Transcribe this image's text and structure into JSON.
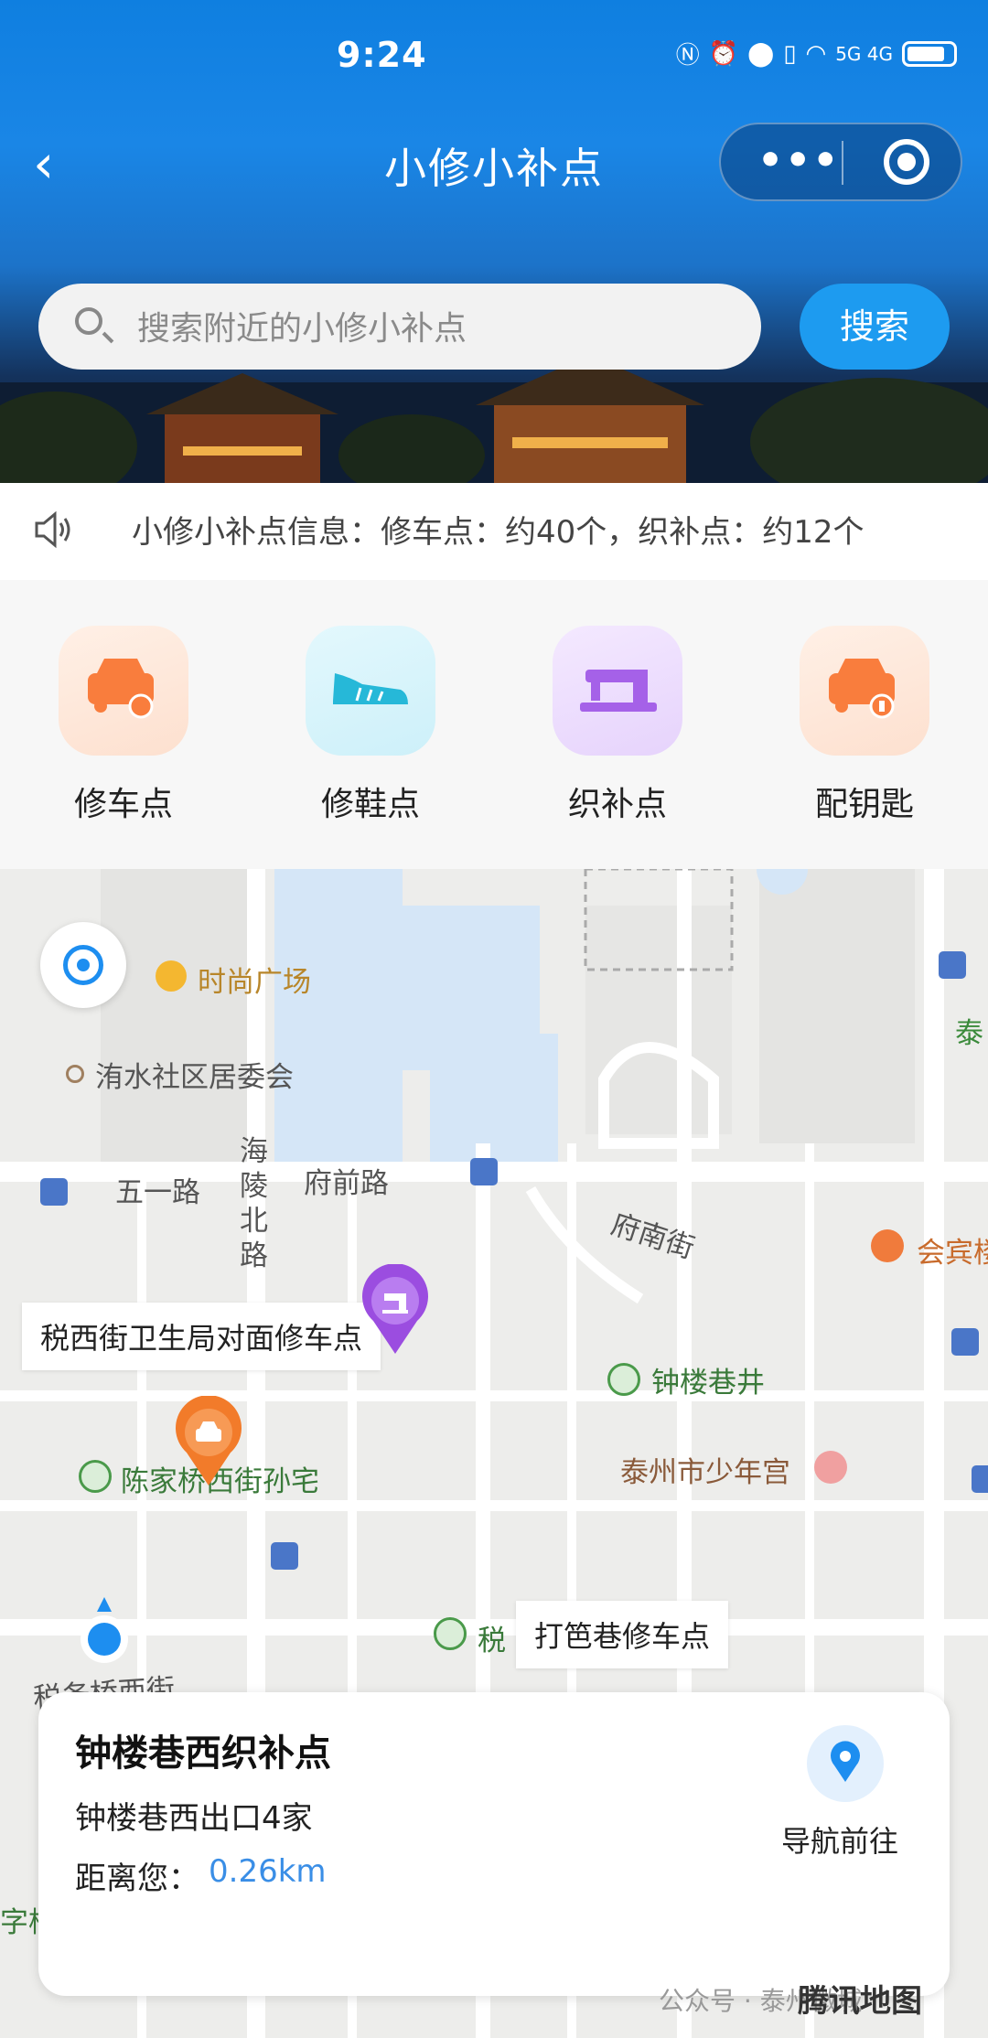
{
  "status_bar": {
    "time": "9:24",
    "network": "5G 4G"
  },
  "nav": {
    "title": "小修小补点",
    "more_label": "•••"
  },
  "search": {
    "placeholder": "搜索附近的小修小补点",
    "button_label": "搜索"
  },
  "notice": {
    "text": "小修小补点信息：修车点：约40个，织补点：约12个"
  },
  "categories": [
    {
      "label": "修车点",
      "icon": "car-repair-icon",
      "color": "#f97d3d"
    },
    {
      "label": "修鞋点",
      "icon": "shoe-icon",
      "color": "#26b8d8"
    },
    {
      "label": "织补点",
      "icon": "sewing-machine-icon",
      "color": "#a561e8"
    },
    {
      "label": "配钥匙",
      "icon": "key-car-icon",
      "color": "#f97d3d"
    }
  ],
  "map": {
    "labels": {
      "shishang": "时尚广场",
      "qingshui": "洧水社区居委会",
      "wuyilu": "五一路",
      "hailingbeilu": "海陵北路",
      "fuqianlu": "府前路",
      "funanjie": "府南街",
      "huibin": "会宾楼",
      "tai": "泰",
      "zhonglouxiangjing": "钟楼巷井",
      "shaoniangong": "泰州市少年宫",
      "chenjia": "陈家桥西街孙宅",
      "shui": "税",
      "shuiduoqiao": "税务桥西街",
      "zi": "字桥"
    },
    "poi_bubbles": {
      "shuixijie": "税西街卫生局对面修车点",
      "dabaxiang": "打笆巷修车点"
    },
    "colors": {
      "water": "#d5e6f7",
      "road": "#ffffff",
      "pin_purple": "#9b4de0",
      "pin_orange": "#f27b2a"
    }
  },
  "card": {
    "title": "钟楼巷西织补点",
    "address": "钟楼巷西出口4家",
    "distance_label": "距离您：",
    "distance_value": "0.26km",
    "nav_label": "导航前往"
  },
  "footer": {
    "watermark": "公众号 · 泰州微城",
    "brand": "腾讯地图"
  }
}
